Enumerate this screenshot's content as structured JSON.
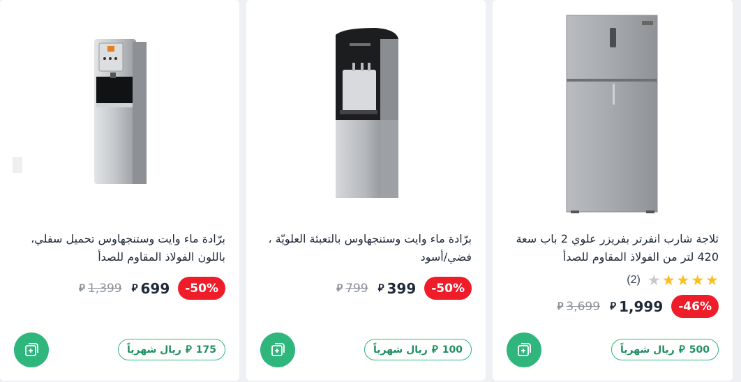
{
  "currency_symbol": "⃁",
  "products": [
    {
      "title_line1": "ثلاجة شارب انفرتر بفريزر علوي 2 باب سعة",
      "title_line2": "420 لتر من الفولاذ المقاوم للصدأ",
      "rating": 5,
      "rating_count": "(2)",
      "discount": "-46%",
      "price": "1,999",
      "old_price": "3,699",
      "monthly": "500",
      "monthly_label": "ريال شهرياً"
    },
    {
      "title_line1": "برّادة ماء وايت وستنجهاوس بالتعبئة العلويّة ،",
      "title_line2": "فضي/أسود",
      "discount": "-50%",
      "price": "399",
      "old_price": "799",
      "monthly": "100",
      "monthly_label": "ريال شهرياً"
    },
    {
      "title_line1": "برّادة ماء وايت وستنجهاوس تحميل سفلي،",
      "title_line2": "باللون الفولاذ المقاوم للصدأ",
      "discount": "-50%",
      "price": "699",
      "old_price": "1,399",
      "monthly": "175",
      "monthly_label": "ريال شهرياً"
    }
  ]
}
